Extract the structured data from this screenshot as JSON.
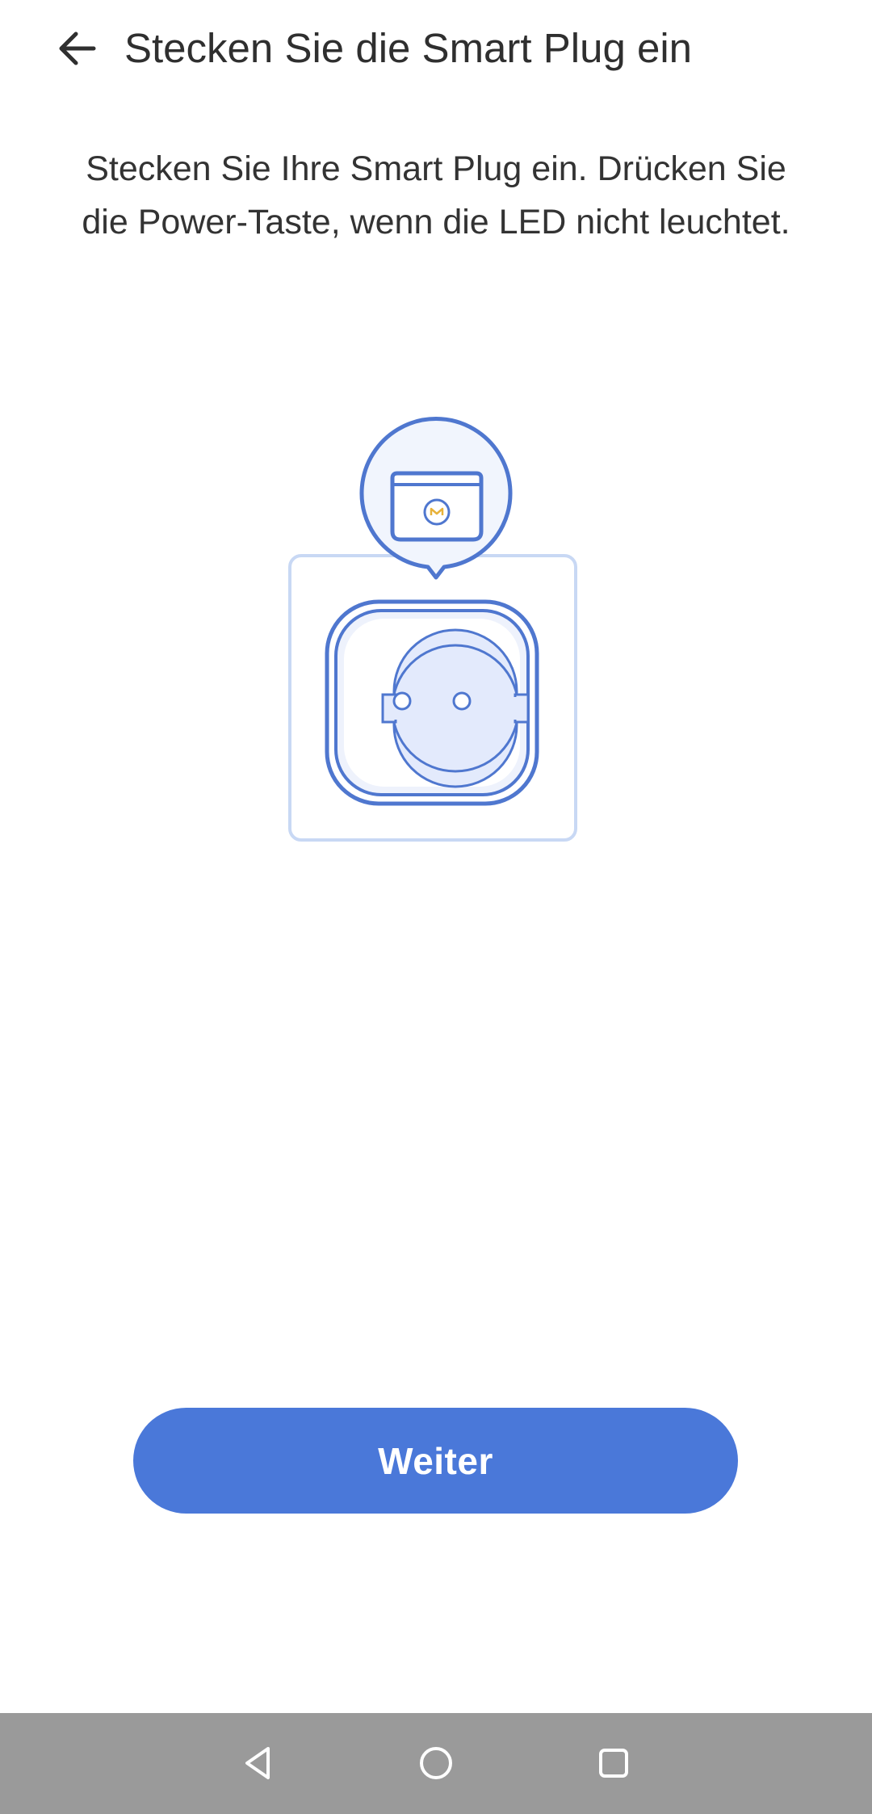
{
  "header": {
    "back_icon": "arrow-left-icon",
    "title": "Stecken Sie die Smart Plug ein"
  },
  "main": {
    "instruction": "Stecken Sie Ihre Smart Plug ein. Drücken Sie die Power-Taste, wenn die LED nicht leuchtet.",
    "illustration_icon": "smart-plug-illustration",
    "next_label": "Weiter"
  },
  "nav_bar": {
    "back_icon": "triangle-back-icon",
    "home_icon": "circle-home-icon",
    "recents_icon": "square-recents-icon"
  },
  "colors": {
    "accent": "#4a78d9",
    "illustration_stroke": "#4f77cf",
    "illustration_fill": "#e3eafc",
    "nav_bar": "#9a9a9a"
  }
}
